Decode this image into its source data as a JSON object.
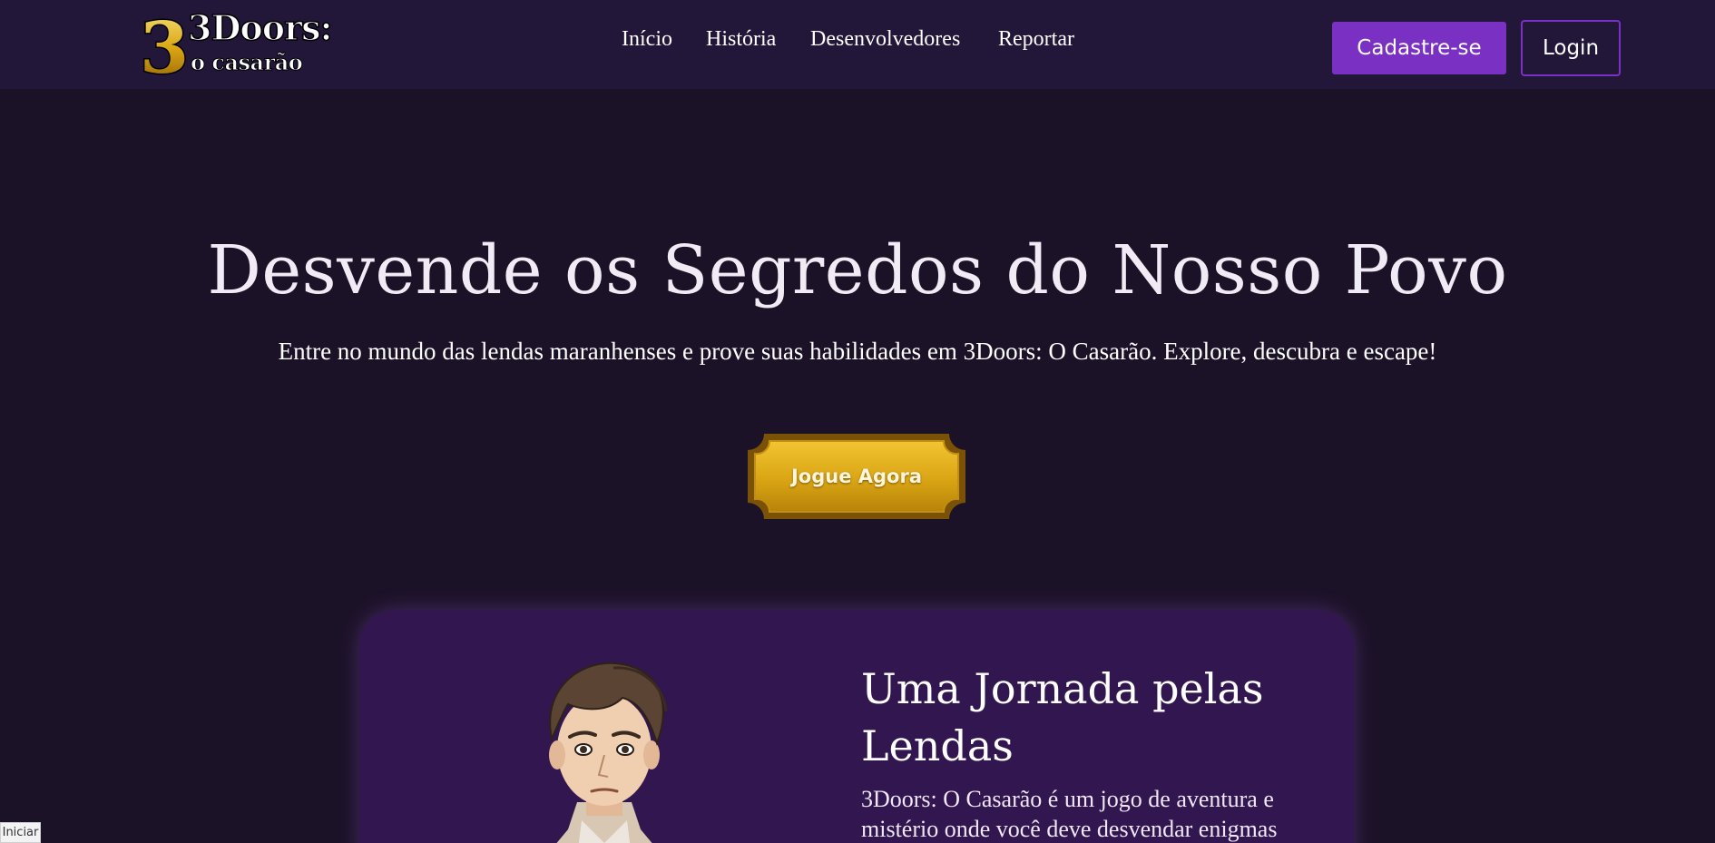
{
  "header": {
    "logo": {
      "text_line1": "3Doors:",
      "text_line2": "O Casarão",
      "icon": "logo-3doors-icon"
    },
    "nav": [
      {
        "label": "Início"
      },
      {
        "label": "História"
      },
      {
        "label": "Desenvolvedores"
      },
      {
        "label": "Reportar"
      }
    ],
    "signup_label": "Cadastre-se",
    "login_label": "Login"
  },
  "hero": {
    "title": "Desvende os Segredos do Nosso Povo",
    "subtitle": "Entre no mundo das lendas maranhenses e prove suas habilidades em 3Doors: O Casarão. Explore, descubra e escape!",
    "cta_label": "Jogue Agora"
  },
  "feature": {
    "title": "Uma Jornada pelas Lendas",
    "text": "3Doors: O Casarão é um jogo de aventura e mistério onde você deve desvendar enigmas",
    "image_icon": "character-portrait-icon"
  },
  "status": {
    "label": "Iniciar"
  },
  "colors": {
    "background": "#1c1228",
    "header": "#221639",
    "accent_purple": "#7b30c4",
    "card": "#32164f",
    "gold": "#d9a514"
  }
}
